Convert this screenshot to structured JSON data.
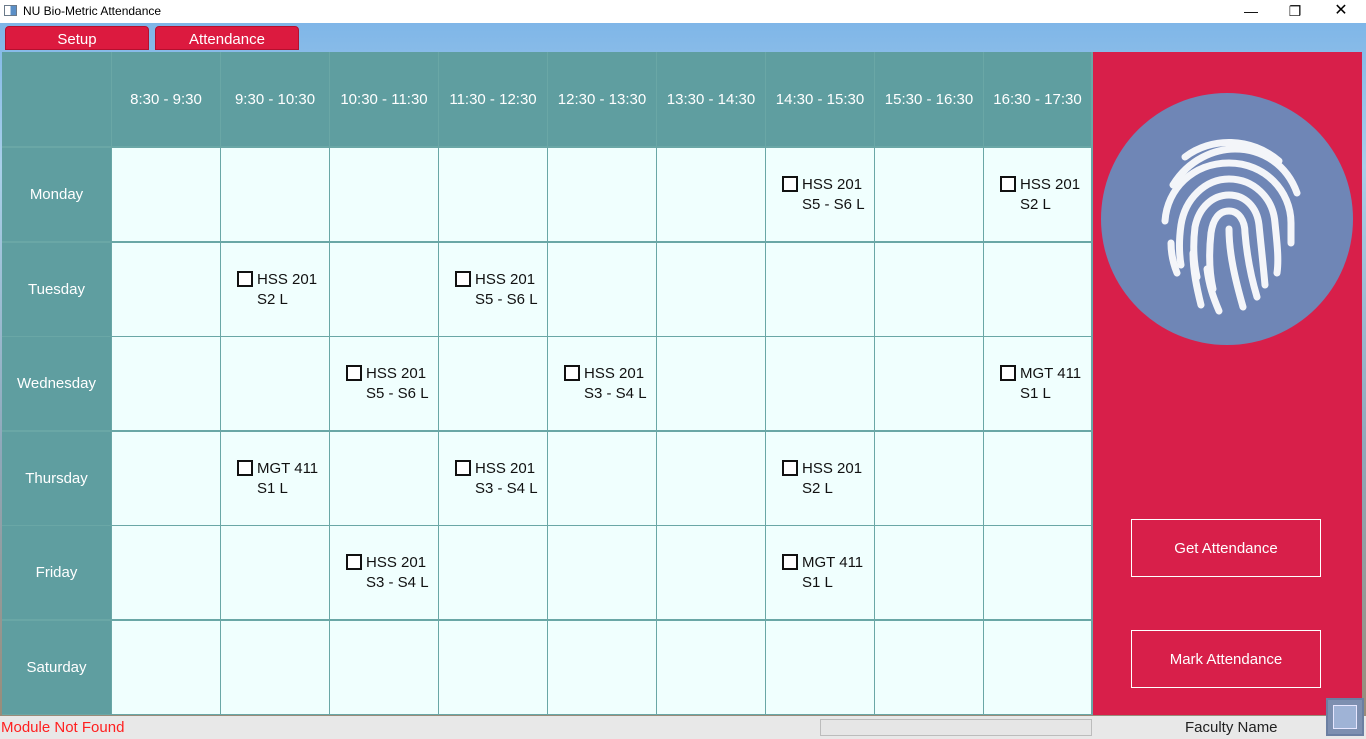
{
  "window": {
    "title": "NU Bio-Metric Attendance",
    "min_glyph": "—",
    "max_glyph": "❐",
    "close_glyph": "✕"
  },
  "tabs": [
    {
      "label": "Setup"
    },
    {
      "label": "Attendance"
    }
  ],
  "timetable": {
    "slots": [
      "8:30 - 9:30",
      "9:30 - 10:30",
      "10:30 - 11:30",
      "11:30 - 12:30",
      "12:30 - 13:30",
      "13:30 - 14:30",
      "14:30 - 15:30",
      "15:30 - 16:30",
      "16:30 - 17:30"
    ],
    "days": [
      "Monday",
      "Tuesday",
      "Wednesday",
      "Thursday",
      "Friday",
      "Saturday"
    ],
    "classes": [
      {
        "day": 0,
        "slot": 6,
        "course": "HSS 201",
        "section": "S5 - S6 L",
        "checked": false
      },
      {
        "day": 0,
        "slot": 8,
        "course": "HSS 201",
        "section": "S2 L",
        "checked": false
      },
      {
        "day": 1,
        "slot": 1,
        "course": "HSS 201",
        "section": "S2 L",
        "checked": false
      },
      {
        "day": 1,
        "slot": 3,
        "course": "HSS 201",
        "section": "S5 - S6 L",
        "checked": false
      },
      {
        "day": 2,
        "slot": 2,
        "course": "HSS 201",
        "section": "S5 - S6 L",
        "checked": false
      },
      {
        "day": 2,
        "slot": 4,
        "course": "HSS 201",
        "section": "S3 - S4 L",
        "checked": false
      },
      {
        "day": 2,
        "slot": 8,
        "course": "MGT 411",
        "section": "S1 L",
        "checked": false
      },
      {
        "day": 3,
        "slot": 1,
        "course": "MGT 411",
        "section": "S1 L",
        "checked": false
      },
      {
        "day": 3,
        "slot": 3,
        "course": "HSS 201",
        "section": "S3 - S4 L",
        "checked": false
      },
      {
        "day": 3,
        "slot": 6,
        "course": "HSS 201",
        "section": "S2 L",
        "checked": false
      },
      {
        "day": 4,
        "slot": 2,
        "course": "HSS 201",
        "section": "S3 - S4 L",
        "checked": false
      },
      {
        "day": 4,
        "slot": 6,
        "course": "MGT 411",
        "section": "S1 L",
        "checked": false
      }
    ]
  },
  "side_panel": {
    "icon": "fingerprint-icon",
    "get_attendance_label": "Get Attendance",
    "mark_attendance_label": "Mark Attendance"
  },
  "status_bar": {
    "status_text": "Module Not Found",
    "faculty_label": "Faculty Name"
  },
  "colors": {
    "accent_red": "#dc1a3f",
    "table_teal": "#5f9ea0",
    "cell_bg": "#f0fffe",
    "status_error": "#ff2020"
  }
}
